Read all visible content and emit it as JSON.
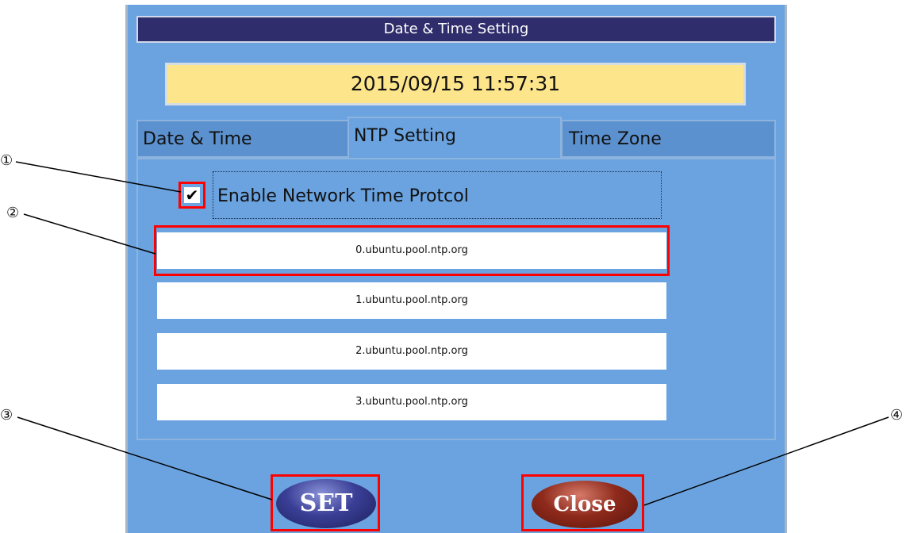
{
  "window": {
    "title": "Date & Time Setting",
    "current_datetime": "2015/09/15 11:57:31"
  },
  "tabs": [
    {
      "label": "Date & Time",
      "active": false
    },
    {
      "label": "NTP Setting",
      "active": true
    },
    {
      "label": "Time Zone",
      "active": false
    }
  ],
  "ntp": {
    "enable_checked": true,
    "check_glyph": "✔",
    "enable_label": "Enable Network Time Protcol",
    "servers": [
      "0.ubuntu.pool.ntp.org",
      "1.ubuntu.pool.ntp.org",
      "2.ubuntu.pool.ntp.org",
      "3.ubuntu.pool.ntp.org"
    ]
  },
  "buttons": {
    "set_label": "SET",
    "close_label": "Close"
  },
  "callouts": [
    "①",
    "②",
    "③",
    "④"
  ],
  "colors": {
    "window_bg": "#6aa3e0",
    "titlebar_bg": "#2f2d6b",
    "clock_bg": "#fde58c",
    "highlight": "#ff0000",
    "set_button": "#3a3f96",
    "close_button": "#8e2a1c"
  }
}
